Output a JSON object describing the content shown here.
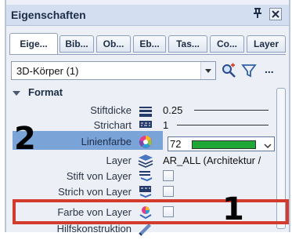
{
  "window": {
    "title": "Eigenschaften",
    "pin_glyph": "ꟸ"
  },
  "tabs": [
    {
      "label": "Eige...",
      "active": true
    },
    {
      "label": "Bib...",
      "active": false
    },
    {
      "label": "Ob...",
      "active": false
    },
    {
      "label": "Eb...",
      "active": false
    },
    {
      "label": "Tas...",
      "active": false
    },
    {
      "label": "Co...",
      "active": false
    },
    {
      "label": "Layer",
      "active": false
    }
  ],
  "selector": {
    "value": "3D-Körper (1)"
  },
  "tools": {
    "more": "..."
  },
  "section": {
    "label": "Format"
  },
  "properties": {
    "stiftdicke": {
      "label": "Stiftdicke",
      "value": "0.25"
    },
    "strichart": {
      "label": "Strichart",
      "value": "1"
    },
    "linienfarbe": {
      "label": "Linienfarbe",
      "value": "72",
      "color": "#1fa836"
    },
    "layer": {
      "label": "Layer",
      "value": "AR_ALL (Architektur /"
    },
    "stift_von_layer": {
      "label": "Stift von Layer"
    },
    "strich_von_layer": {
      "label": "Strich von Layer"
    },
    "farbe_von_layer": {
      "label": "Farbe von Layer"
    },
    "hilfskonstruktion": {
      "label": "Hilfskonstruktion"
    }
  },
  "annotations": {
    "marker_1": "1",
    "marker_2": "2",
    "box_color": "#d33b2c"
  }
}
